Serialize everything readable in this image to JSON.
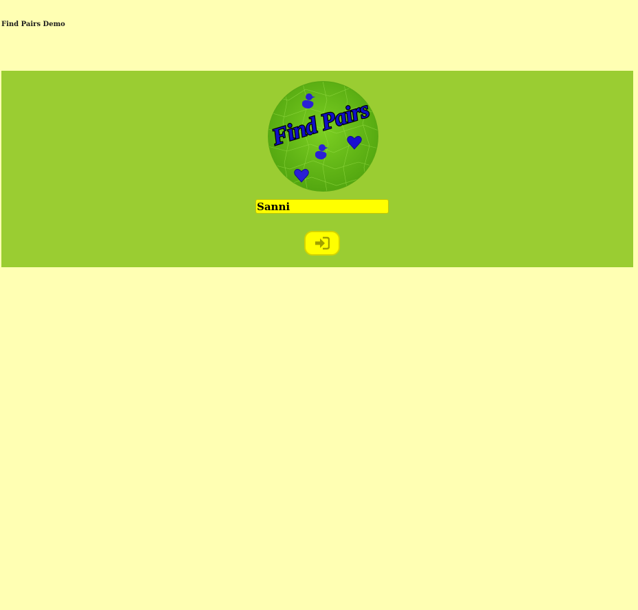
{
  "page": {
    "title": "Find Pairs Demo"
  },
  "logo": {
    "text": "Find Pairs",
    "icons": [
      "duck-icon",
      "duck-icon",
      "heart-icon",
      "heart-icon"
    ]
  },
  "login": {
    "name_value": "Sanni",
    "button_icon": "sign-in-icon"
  },
  "colors": {
    "page_background": "#ffffb3",
    "panel_background": "#9acd32",
    "input_background": "#ffff00",
    "button_background": "#ffff00",
    "icon_color": "#a0a000",
    "logo_icon_color": "#2a1fd6"
  }
}
